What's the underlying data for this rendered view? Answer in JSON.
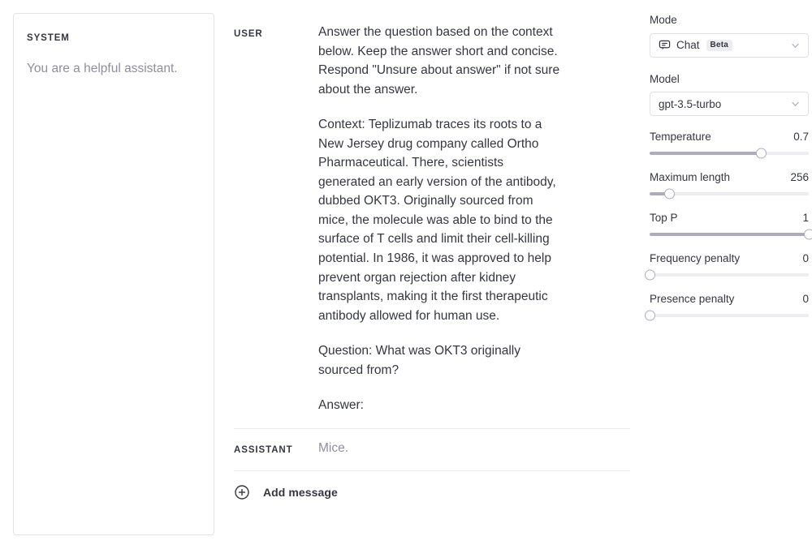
{
  "system": {
    "role_label": "SYSTEM",
    "text": "You are a helpful assistant."
  },
  "conversation": {
    "messages": [
      {
        "role_label": "USER",
        "paragraphs": [
          "Answer the question based on the context below. Keep the answer short and concise. Respond \"Unsure about answer\" if not sure about the answer.",
          "Context: Teplizumab traces its roots to a New Jersey drug company called Ortho Pharmaceutical. There, scientists generated an early version of the antibody, dubbed OKT3. Originally sourced from mice, the molecule was able to bind to the surface of T cells and limit their cell-killing potential. In 1986, it was approved to help prevent organ rejection after kidney transplants, making it the first therapeutic antibody allowed for human use.",
          "Question: What was OKT3 originally sourced from?",
          "Answer:"
        ]
      },
      {
        "role_label": "ASSISTANT",
        "paragraphs": [
          "Mice."
        ]
      }
    ],
    "add_message_label": "Add message",
    "add_message_icon": "plus-circle-icon"
  },
  "parameters": {
    "mode": {
      "label": "Mode",
      "value": "Chat",
      "badge": "Beta",
      "icon": "chat-bubble-icon",
      "chevron": "chevron-down-icon"
    },
    "model": {
      "label": "Model",
      "value": "gpt-3.5-turbo",
      "chevron": "chevron-down-icon"
    },
    "sliders": [
      {
        "label": "Temperature",
        "value": "0.7",
        "percent": 70
      },
      {
        "label": "Maximum length",
        "value": "256",
        "percent": 12.5
      },
      {
        "label": "Top P",
        "value": "1",
        "percent": 100
      },
      {
        "label": "Frequency penalty",
        "value": "0",
        "percent": 0
      },
      {
        "label": "Presence penalty",
        "value": "0",
        "percent": 0
      }
    ]
  },
  "colors": {
    "text": "#353740",
    "muted": "#8e8ea0",
    "border": "#e3e3e6",
    "track": "#ececf1",
    "track_fill": "#acacbe"
  }
}
